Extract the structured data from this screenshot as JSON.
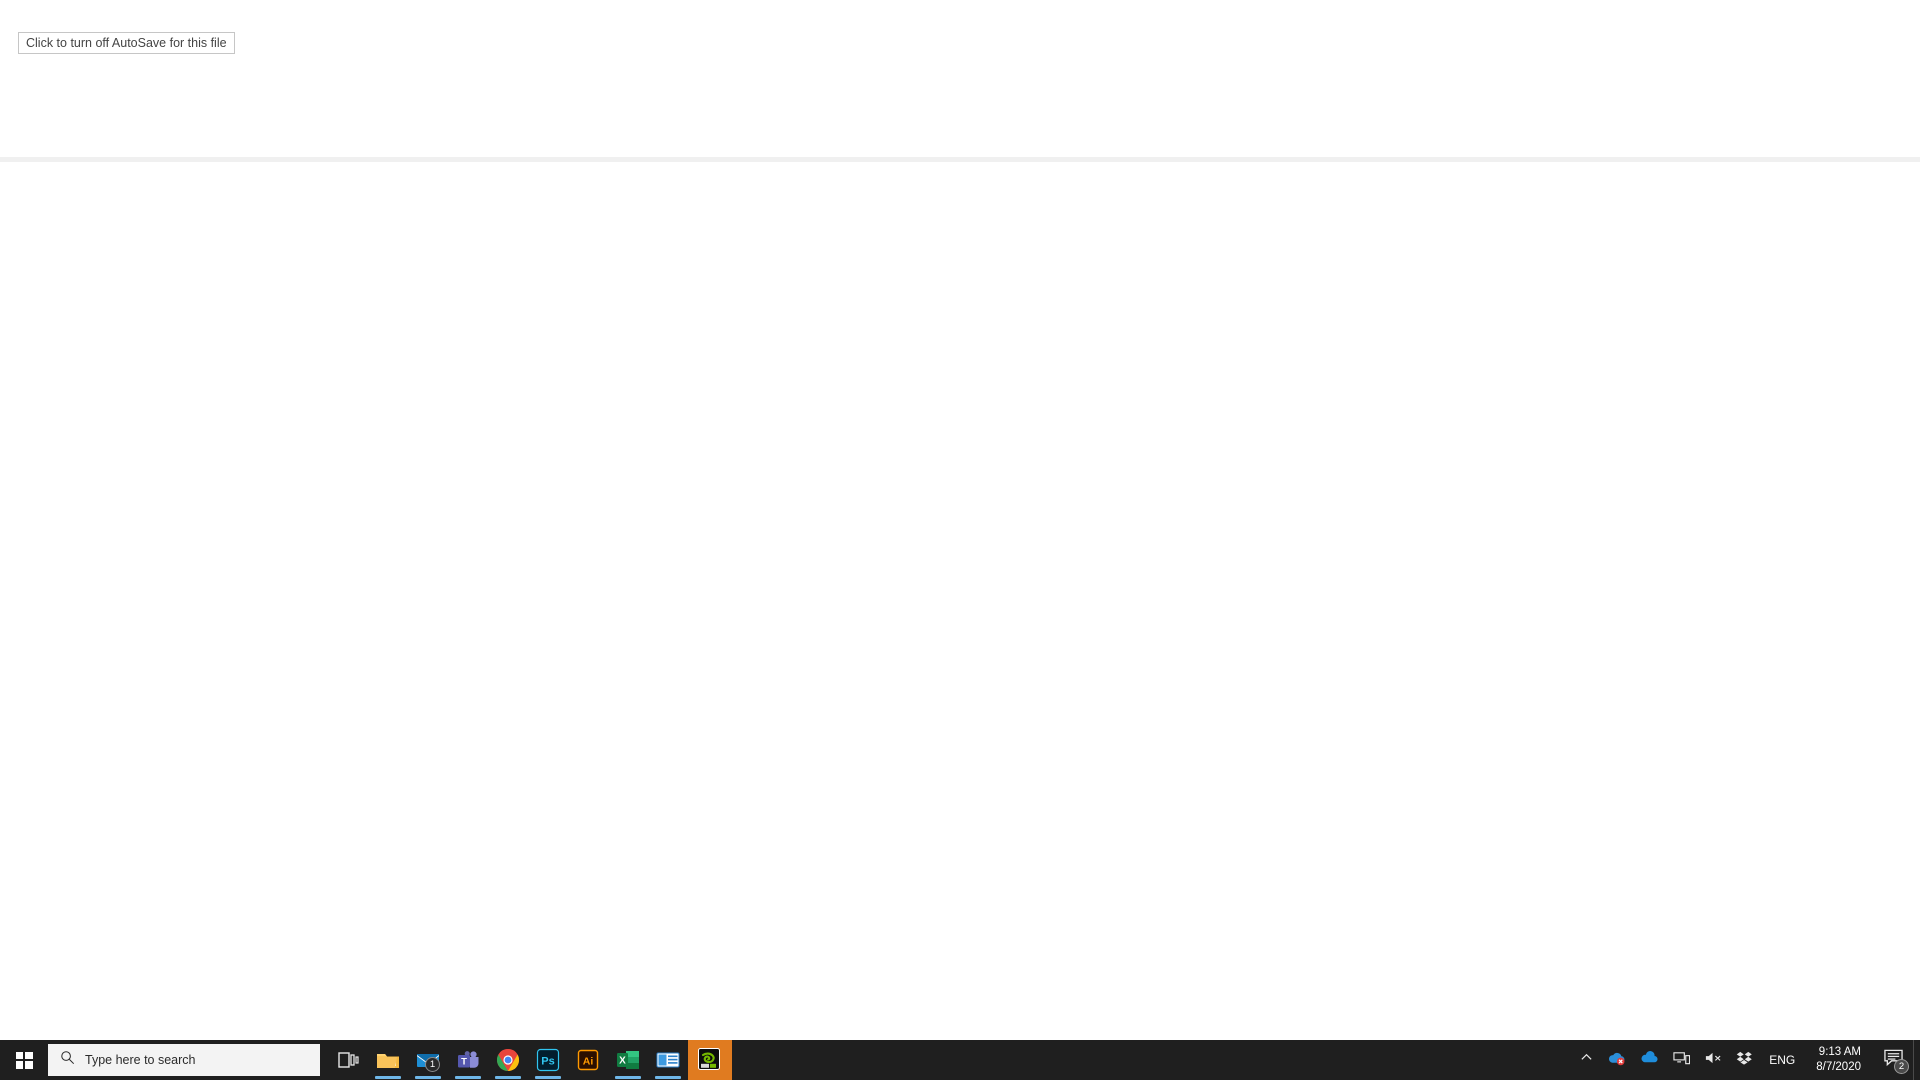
{
  "window": {
    "surface_background": "#ffffff",
    "divider_color": "#f0f0f0"
  },
  "tooltip": {
    "text": "Click to turn off AutoSave for this file",
    "border_color": "#c6c6c6",
    "text_color": "#444444",
    "background": "#ffffff"
  },
  "taskbar": {
    "background": "#1f1f1f",
    "start": {
      "name": "Start",
      "icon": "windows-logo-icon"
    },
    "search": {
      "placeholder": "Type here to search",
      "value": "",
      "icon": "search-icon",
      "background": "#f3f3f3"
    },
    "task_view": {
      "label": "Task View",
      "icon": "task-view-icon"
    },
    "running_indicator_color": "#6fb7e8",
    "active_highlight_color": "#e07b20",
    "apps": [
      {
        "label": "File Explorer",
        "icon": "file-explorer-icon",
        "running": true,
        "active": false,
        "badge": ""
      },
      {
        "label": "Mail",
        "icon": "mail-icon",
        "running": true,
        "active": false,
        "badge": "1"
      },
      {
        "label": "Microsoft Teams",
        "icon": "teams-icon",
        "running": true,
        "active": false,
        "badge": ""
      },
      {
        "label": "Google Chrome",
        "icon": "chrome-icon",
        "running": true,
        "active": false,
        "badge": ""
      },
      {
        "label": "Adobe Photoshop",
        "icon": "photoshop-icon",
        "running": true,
        "active": false,
        "badge": ""
      },
      {
        "label": "Adobe Illustrator",
        "icon": "illustrator-icon",
        "running": false,
        "active": false,
        "badge": ""
      },
      {
        "label": "Microsoft Excel",
        "icon": "excel-icon",
        "running": true,
        "active": false,
        "badge": ""
      },
      {
        "label": "Microsoft PowerPoint",
        "icon": "powerpoint-icon",
        "running": true,
        "active": false,
        "badge": ""
      },
      {
        "label": "NVIDIA GeForce Experience",
        "icon": "nvidia-icon",
        "running": true,
        "active": true,
        "badge": ""
      }
    ],
    "tray": {
      "show_hidden": {
        "label": "Show hidden icons",
        "icon": "chevron-up-icon"
      },
      "icons": [
        {
          "label": "OneDrive - sign in problem",
          "icon": "onedrive-error-icon"
        },
        {
          "label": "OneDrive",
          "icon": "onedrive-icon"
        },
        {
          "label": "Network",
          "icon": "network-icon"
        },
        {
          "label": "Volume muted",
          "icon": "speaker-mute-icon"
        },
        {
          "label": "Dropbox",
          "icon": "dropbox-icon"
        }
      ],
      "language": "ENG",
      "clock": {
        "time": "9:13 AM",
        "date": "8/7/2020"
      },
      "notifications": {
        "label": "Notifications",
        "icon": "notification-bubble-icon",
        "count": "2"
      },
      "show_desktop": {
        "label": "Show desktop"
      }
    }
  }
}
